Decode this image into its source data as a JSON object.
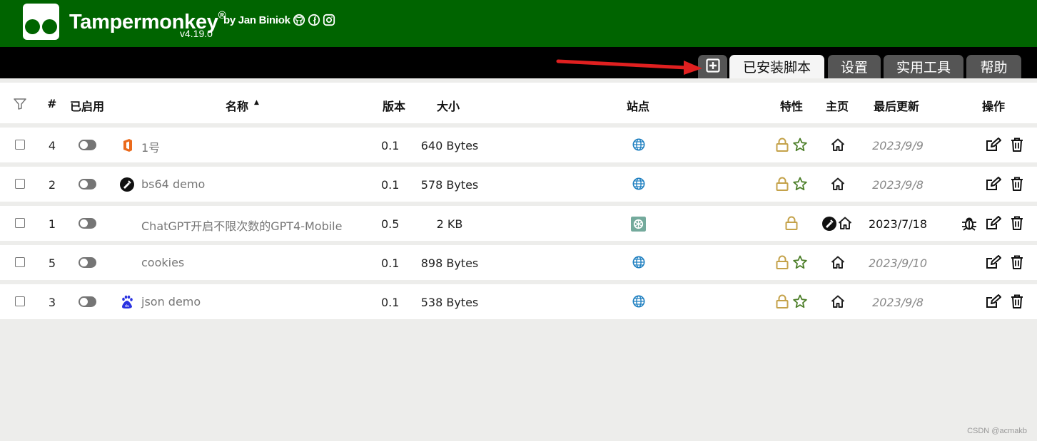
{
  "header": {
    "app_name": "Tampermonkey",
    "reg": "®",
    "by": "by Jan Biniok",
    "version": "v4.19.0",
    "social_icons": [
      "github-icon",
      "facebook-icon",
      "instagram-icon"
    ]
  },
  "tabs": [
    {
      "icon": "add-script-icon"
    },
    {
      "label": "已安装脚本",
      "active": true
    },
    {
      "label": "设置"
    },
    {
      "label": "实用工具"
    },
    {
      "label": "帮助"
    }
  ],
  "columns": {
    "filter_icon": "filter-icon",
    "index": "#",
    "enabled": "已启用",
    "name": "名称",
    "sort_indicator": "▲",
    "version": "版本",
    "size": "大小",
    "sites": "站点",
    "features": "特性",
    "homepage": "主页",
    "updated": "最后更新",
    "actions": "操作"
  },
  "scripts": [
    {
      "index": "4",
      "name": "1号",
      "icon": "office-icon",
      "version": "0.1",
      "size": "640 Bytes",
      "site_icon": "globe-icon",
      "features": [
        "lock-icon",
        "star-icon"
      ],
      "homepage": [
        "home-icon"
      ],
      "updated": "2023/9/9",
      "updated_italic": true,
      "actions": [
        "edit-icon",
        "trash-icon"
      ]
    },
    {
      "index": "2",
      "name": "bs64 demo",
      "icon": "script-icon",
      "version": "0.1",
      "size": "578 Bytes",
      "site_icon": "globe-icon",
      "features": [
        "lock-icon",
        "star-icon"
      ],
      "homepage": [
        "home-icon"
      ],
      "updated": "2023/9/8",
      "updated_italic": true,
      "actions": [
        "edit-icon",
        "trash-icon"
      ]
    },
    {
      "index": "1",
      "name": "ChatGPT开启不限次数的GPT4-Mobile",
      "icon": "",
      "version": "0.5",
      "size": "2 KB",
      "site_icon": "chatgpt-icon",
      "features": [
        "lock-icon"
      ],
      "homepage": [
        "script-icon",
        "home-icon"
      ],
      "updated": "2023/7/18",
      "updated_italic": false,
      "actions": [
        "bug-icon",
        "edit-icon",
        "trash-icon"
      ]
    },
    {
      "index": "5",
      "name": "cookies",
      "icon": "",
      "version": "0.1",
      "size": "898 Bytes",
      "site_icon": "globe-icon",
      "features": [
        "lock-icon",
        "star-icon"
      ],
      "homepage": [
        "home-icon"
      ],
      "updated": "2023/9/10",
      "updated_italic": true,
      "actions": [
        "edit-icon",
        "trash-icon"
      ]
    },
    {
      "index": "3",
      "name": "json demo",
      "icon": "baidu-icon",
      "version": "0.1",
      "size": "538 Bytes",
      "site_icon": "globe-icon",
      "features": [
        "lock-icon",
        "star-icon"
      ],
      "homepage": [
        "home-icon"
      ],
      "updated": "2023/9/8",
      "updated_italic": true,
      "actions": [
        "edit-icon",
        "trash-icon"
      ]
    }
  ],
  "watermark": "CSDN @acmakb",
  "colors": {
    "header_bg": "#006400",
    "tab_inactive": "#555555",
    "lock": "#c4a24a",
    "star": "#4d7f2a",
    "globe": "#1e7fc0",
    "annotation_arrow": "#e02020"
  }
}
